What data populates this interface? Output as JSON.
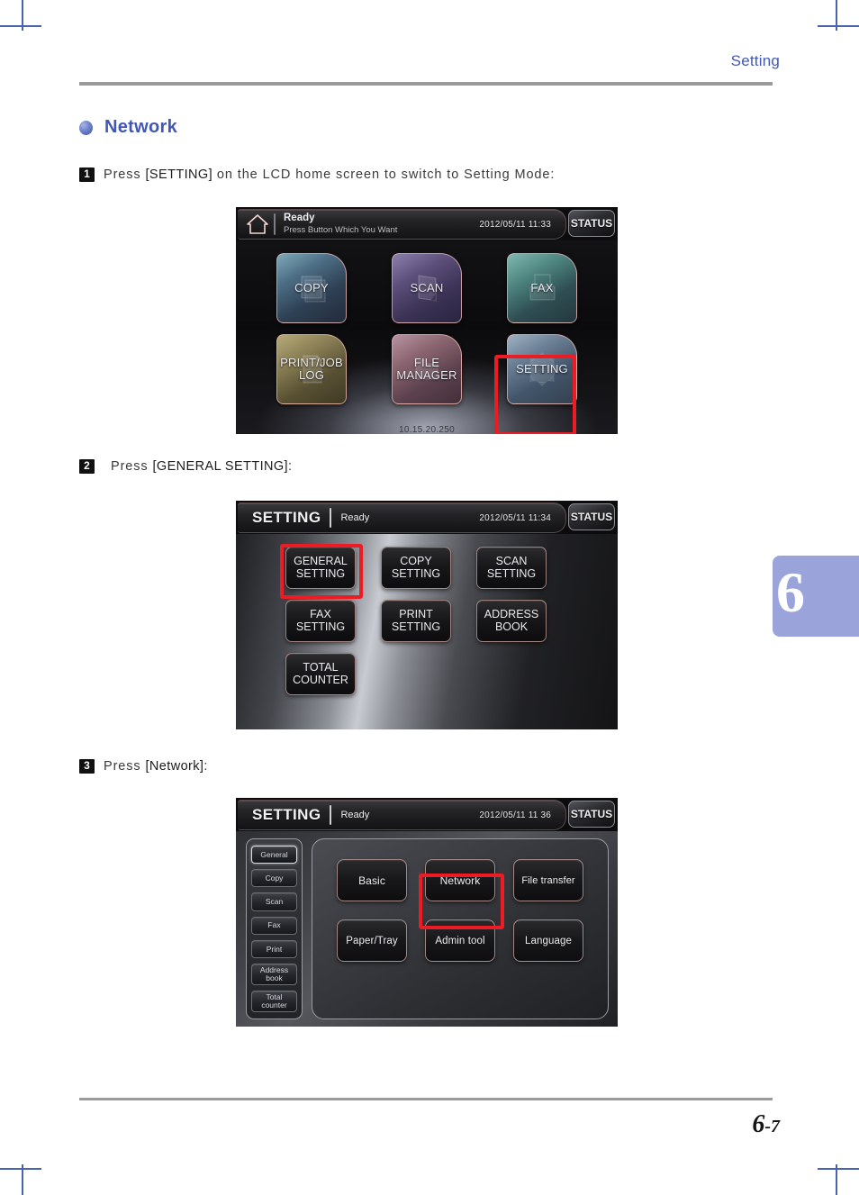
{
  "page": {
    "running_header": "Setting",
    "chapter_tab": "6",
    "page_number_major": "6",
    "page_number_separator": "-",
    "page_number_minor": "7"
  },
  "section": {
    "bullet_icon": "bullet-dot-icon",
    "title": "Network"
  },
  "steps": [
    {
      "number": "1",
      "text_before": "Press ",
      "key": "[SETTING]",
      "text_after": " on the LCD home screen to switch to Setting Mode:"
    },
    {
      "number": "2",
      "text_before": "Press ",
      "key": "[GENERAL SETTING]",
      "text_after": ":"
    },
    {
      "number": "3",
      "text_before": "Press ",
      "key": "[Network]",
      "text_after": ":"
    }
  ],
  "lcd_home": {
    "home_icon": "home-icon",
    "status_title": "Ready",
    "status_sub": "Press Button Which You Want",
    "datetime": "2012/05/11 11:33",
    "status_button": "STATUS",
    "ip_address": "10.15.20.250",
    "tiles": [
      {
        "label": "COPY",
        "icon": "copy-icon"
      },
      {
        "label": "SCAN",
        "icon": "scan-icon"
      },
      {
        "label": "FAX",
        "icon": "fax-icon"
      },
      {
        "label": "PRINT/JOB\nLOG",
        "icon": "print-job-log-icon"
      },
      {
        "label": "FILE\nMANAGER",
        "icon": "file-manager-icon"
      },
      {
        "label": "SETTING",
        "icon": "gear-icon"
      }
    ],
    "highlighted_tile": "SETTING"
  },
  "lcd_setting_menu": {
    "mode_label": "SETTING",
    "status_title": "Ready",
    "datetime": "2012/05/11 11:34",
    "status_button": "STATUS",
    "buttons": [
      "GENERAL\nSETTING",
      "COPY\nSETTING",
      "SCAN\nSETTING",
      "FAX\nSETTING",
      "PRINT\nSETTING",
      "ADDRESS\nBOOK",
      "TOTAL\nCOUNTER"
    ],
    "highlighted_button": "GENERAL SETTING"
  },
  "lcd_general_setting": {
    "mode_label": "SETTING",
    "status_title": "Ready",
    "datetime": "2012/05/11 11 36",
    "status_button": "STATUS",
    "side_nav": [
      {
        "label": "General",
        "active": true
      },
      {
        "label": "Copy",
        "active": false
      },
      {
        "label": "Scan",
        "active": false
      },
      {
        "label": "Fax",
        "active": false
      },
      {
        "label": "Print",
        "active": false
      },
      {
        "label": "Address\nbook",
        "active": false
      },
      {
        "label": "Total\ncounter",
        "active": false
      }
    ],
    "buttons": [
      "Basic",
      "Network",
      "File transfer",
      "Paper/Tray",
      "Admin tool",
      "Language"
    ],
    "highlighted_button": "Network"
  },
  "colors": {
    "accent_blue": "#4257b5",
    "highlight_red": "#ec1c24",
    "chapter_tab": "#9aa4da",
    "rule_gray": "#9a9a9a"
  }
}
